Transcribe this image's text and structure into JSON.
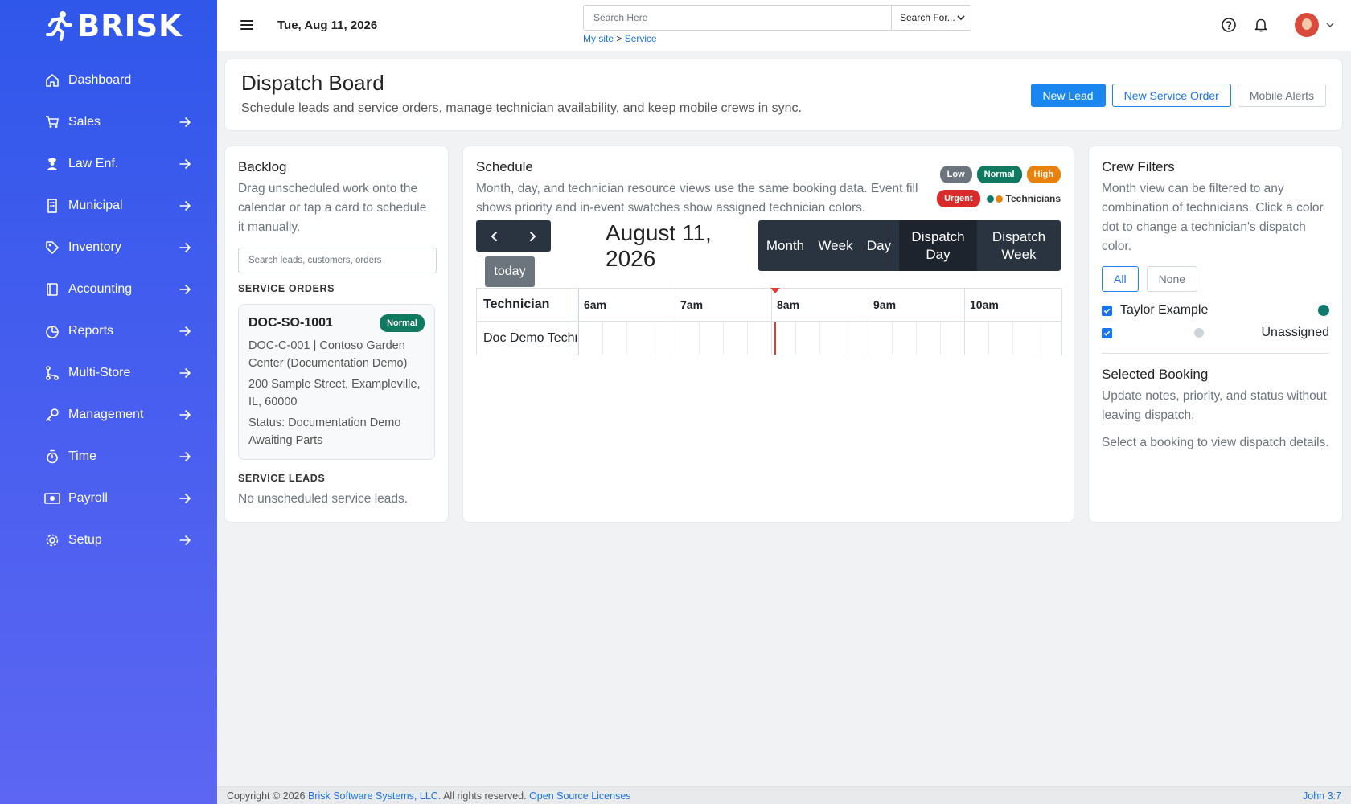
{
  "brand": {
    "name": "BRISK"
  },
  "sidebar": {
    "items": [
      {
        "label": "Dashboard",
        "icon": "home-icon"
      },
      {
        "label": "Sales",
        "icon": "cart-icon"
      },
      {
        "label": "Law Enf.",
        "icon": "officer-icon"
      },
      {
        "label": "Municipal",
        "icon": "building-icon"
      },
      {
        "label": "Inventory",
        "icon": "tag-icon"
      },
      {
        "label": "Accounting",
        "icon": "ledger-icon"
      },
      {
        "label": "Reports",
        "icon": "chart-icon"
      },
      {
        "label": "Multi-Store",
        "icon": "branch-icon"
      },
      {
        "label": "Management",
        "icon": "key-icon"
      },
      {
        "label": "Time",
        "icon": "stopwatch-icon"
      },
      {
        "label": "Payroll",
        "icon": "money-icon"
      },
      {
        "label": "Setup",
        "icon": "gear-icon"
      }
    ]
  },
  "topbar": {
    "date": "Tue, Aug 11, 2026",
    "search_placeholder": "Search Here",
    "search_for": "Search For...",
    "breadcrumb": {
      "root": "My site",
      "sep": ">",
      "current": "Service"
    }
  },
  "header": {
    "title": "Dispatch Board",
    "subtitle": "Schedule leads and service orders, manage technician availability, and keep mobile crews in sync.",
    "buttons": {
      "new_lead": "New Lead",
      "new_service_order": "New Service Order",
      "mobile_alerts": "Mobile Alerts"
    }
  },
  "backlog": {
    "title": "Backlog",
    "description": "Drag unscheduled work onto the calendar or tap a card to schedule it manually.",
    "search_placeholder": "Search leads, customers, orders",
    "service_orders_label": "SERVICE ORDERS",
    "order": {
      "id": "DOC-SO-1001",
      "priority": "Normal",
      "customer": "DOC-C-001 | Contoso Garden Center (Documentation Demo)",
      "address": "200 Sample Street, Exampleville, IL, 60000",
      "status": "Status: Documentation Demo Awaiting Parts"
    },
    "service_leads_label": "SERVICE LEADS",
    "no_leads": "No unscheduled service leads."
  },
  "schedule": {
    "title": "Schedule",
    "description": "Month, day, and technician resource views use the same booking data. Event fill shows priority and in-event swatches show assigned technician colors.",
    "legend": {
      "low": "Low",
      "normal": "Normal",
      "high": "High",
      "urgent": "Urgent",
      "technicians": "Technicians"
    },
    "today": "today",
    "current_title": "August 11, 2026",
    "views": [
      "Month",
      "Week",
      "Day",
      "Dispatch Day",
      "Dispatch Week"
    ],
    "active_view": "Dispatch Day",
    "column_header": "Technician",
    "hours": [
      "6am",
      "7am",
      "8am",
      "9am",
      "10am"
    ],
    "row_label": "Doc Demo Technician"
  },
  "crew": {
    "title": "Crew Filters",
    "description": "Month view can be filtered to any combination of technicians. Click a color dot to change a technician's dispatch color.",
    "all": "All",
    "none": "None",
    "technicians": [
      {
        "name": "Taylor Example",
        "color": "#0f7a6c",
        "checked": true
      },
      {
        "name": "Unassigned",
        "color": "#cfd4da",
        "checked": true
      }
    ],
    "selected_title": "Selected Booking",
    "selected_desc": "Update notes, priority, and status without leaving dispatch.",
    "selected_empty": "Select a booking to view dispatch details."
  },
  "footer": {
    "copyright": "Copyright © 2026",
    "company": "Brisk Software Systems, LLC.",
    "rights": "All rights reserved.",
    "licenses": "Open Source Licenses",
    "verse": "John 3:7"
  },
  "colors": {
    "accent": "#1a87f0",
    "sidebar": "#3a5af0",
    "normal": "#0f7a5f",
    "low": "#6c757d",
    "high": "#e8820c",
    "urgent": "#d92b2b"
  }
}
